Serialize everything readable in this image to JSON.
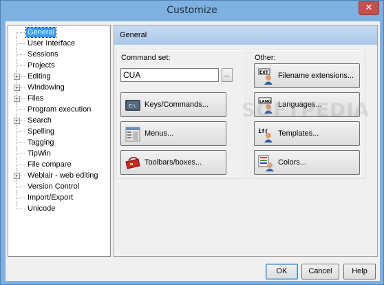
{
  "window": {
    "title": "Customize"
  },
  "tree": {
    "items": [
      {
        "label": "General",
        "expandable": false,
        "selected": true
      },
      {
        "label": "User Interface",
        "expandable": false,
        "selected": false
      },
      {
        "label": "Sessions",
        "expandable": false,
        "selected": false
      },
      {
        "label": "Projects",
        "expandable": false,
        "selected": false
      },
      {
        "label": "Editing",
        "expandable": true,
        "selected": false
      },
      {
        "label": "Windowing",
        "expandable": true,
        "selected": false
      },
      {
        "label": "Files",
        "expandable": true,
        "selected": false
      },
      {
        "label": "Program execution",
        "expandable": false,
        "selected": false
      },
      {
        "label": "Search",
        "expandable": true,
        "selected": false
      },
      {
        "label": "Spelling",
        "expandable": false,
        "selected": false
      },
      {
        "label": "Tagging",
        "expandable": false,
        "selected": false
      },
      {
        "label": "TipWin",
        "expandable": false,
        "selected": false
      },
      {
        "label": "File compare",
        "expandable": false,
        "selected": false
      },
      {
        "label": "Weblair - web editing",
        "expandable": true,
        "selected": false
      },
      {
        "label": "Version Control",
        "expandable": false,
        "selected": false
      },
      {
        "label": "Import/Export",
        "expandable": false,
        "selected": false
      },
      {
        "label": "Unicode",
        "expandable": false,
        "selected": false
      }
    ]
  },
  "panel": {
    "title": "General",
    "command_set": {
      "label": "Command set:",
      "value": "CUA",
      "browse_label": "...",
      "buttons": {
        "keys": "Keys/Commands...",
        "menus": "Menus...",
        "toolbars": "Toolbars/boxes..."
      }
    },
    "other": {
      "label": "Other:",
      "buttons": {
        "extensions": "Filename extensions...",
        "languages": "Languages...",
        "templates": "Templates...",
        "colors": "Colors..."
      },
      "icon_text": {
        "ext": "EXT",
        "lang": "LANG",
        "template": "if{"
      }
    }
  },
  "footer": {
    "ok": "OK",
    "cancel": "Cancel",
    "help": "Help"
  },
  "close_glyph": "✕",
  "expander_glyph": "+",
  "watermark": "SOFTPEDIA"
}
